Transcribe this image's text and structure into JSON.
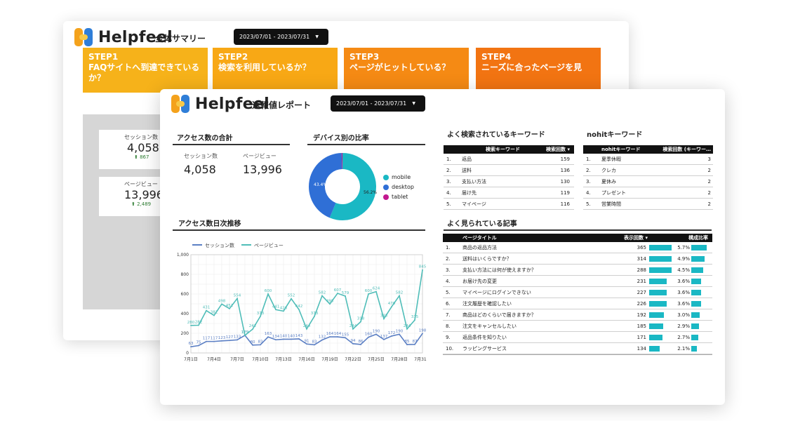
{
  "background_report": {
    "brand": "Helpfeel",
    "title": "全体サマリー",
    "date_range": "2023/07/01 - 2023/07/31",
    "steps": [
      {
        "label": "STEP1",
        "text": "FAQサイトへ到達できているか？",
        "color": "#f6b21a"
      },
      {
        "label": "STEP2",
        "text": "検索を利用しているか？",
        "color": "#f8a815"
      },
      {
        "label": "STEP3",
        "text": "ページがヒットしている？",
        "color": "#f58a14"
      },
      {
        "label": "STEP4",
        "text": "ニーズに合ったページを見",
        "color": "#f27412"
      }
    ],
    "kpis": [
      {
        "label": "セッション数",
        "value": "4,058",
        "delta": "⬆ 867"
      },
      {
        "label": "ページビュー",
        "value": "13,996",
        "delta": "⬆ 2,489"
      }
    ]
  },
  "report": {
    "brand": "Helpfeel",
    "title": "速報値レポート",
    "date_range": "2023/07/01 - 2023/07/31",
    "access_total": {
      "title": "アクセス数の合計",
      "sessions_label": "セッション数",
      "sessions_value": "4,058",
      "pageviews_label": "ページビュー",
      "pageviews_value": "13,996"
    },
    "device": {
      "title": "デバイス別の比率",
      "labels": [
        "56.2%",
        "43.4%"
      ]
    },
    "daily": {
      "title": "アクセス数日次推移"
    },
    "keywords": {
      "title": "よく検索されているキーワード",
      "col_keyword": "検索キーワード",
      "col_count": "検索回数 ▾",
      "rows": [
        {
          "n": "1.",
          "k": "返品",
          "v": "159"
        },
        {
          "n": "2.",
          "k": "送料",
          "v": "136"
        },
        {
          "n": "3.",
          "k": "支払い方法",
          "v": "130"
        },
        {
          "n": "4.",
          "k": "届け先",
          "v": "119"
        },
        {
          "n": "5.",
          "k": "マイページ",
          "v": "116"
        }
      ]
    },
    "nohit": {
      "title": "nohitキーワード",
      "col_keyword": "nohitキーワード",
      "col_count": "検索回数 (キーワー…",
      "rows": [
        {
          "n": "1.",
          "k": "夏季休暇",
          "v": "3"
        },
        {
          "n": "2.",
          "k": "クレカ",
          "v": "2"
        },
        {
          "n": "3.",
          "k": "夏休み",
          "v": "2"
        },
        {
          "n": "4.",
          "k": "プレゼント",
          "v": "2"
        },
        {
          "n": "5.",
          "k": "営業時間",
          "v": "2"
        }
      ]
    },
    "articles": {
      "title": "よく見られている記事",
      "col_title": "ページタイトル",
      "col_views": "表示回数 ▾",
      "col_ratio": "構成比率",
      "rows": [
        {
          "n": "1.",
          "t": "商品の返品方法",
          "v": "365",
          "r": "5.7%",
          "ratio": 5.7
        },
        {
          "n": "2.",
          "t": "送料はいくらですか？",
          "v": "314",
          "r": "4.9%",
          "ratio": 4.9
        },
        {
          "n": "3.",
          "t": "支払い方法には何が使えますか？",
          "v": "288",
          "r": "4.5%",
          "ratio": 4.5
        },
        {
          "n": "4.",
          "t": "お届け先の変更",
          "v": "231",
          "r": "3.6%",
          "ratio": 3.6
        },
        {
          "n": "5.",
          "t": "マイページにログインできない",
          "v": "227",
          "r": "3.6%",
          "ratio": 3.6
        },
        {
          "n": "6.",
          "t": "注文履歴を確認したい",
          "v": "226",
          "r": "3.6%",
          "ratio": 3.6
        },
        {
          "n": "7.",
          "t": "商品はどのくらいで届きますか？",
          "v": "192",
          "r": "3.0%",
          "ratio": 3.0
        },
        {
          "n": "8.",
          "t": "注文をキャンセルしたい",
          "v": "185",
          "r": "2.9%",
          "ratio": 2.9
        },
        {
          "n": "9.",
          "t": "返品条件を知りたい",
          "v": "171",
          "r": "2.7%",
          "ratio": 2.7
        },
        {
          "n": "10.",
          "t": "ラッピングサービス",
          "v": "134",
          "r": "2.1%",
          "ratio": 2.1
        }
      ]
    }
  },
  "chart_data": [
    {
      "type": "pie",
      "title": "デバイス別の比率",
      "categories": [
        "mobile",
        "desktop",
        "tablet"
      ],
      "values": [
        56.2,
        43.4,
        0.4
      ],
      "colors": [
        "#1ab8c4",
        "#2f6fd6",
        "#c2188f"
      ],
      "legend": "right"
    },
    {
      "type": "line",
      "title": "アクセス数日次推移",
      "x": [
        "7月1日",
        "7月2日",
        "7月3日",
        "7月4日",
        "7月5日",
        "7月6日",
        "7月7日",
        "7月8日",
        "7月9日",
        "7月10日",
        "7月11日",
        "7月12日",
        "7月13日",
        "7月14日",
        "7月15日",
        "7月16日",
        "7月17日",
        "7月18日",
        "7月19日",
        "7月20日",
        "7月21日",
        "7月22日",
        "7月23日",
        "7月24日",
        "7月25日",
        "7月26日",
        "7月27日",
        "7月28日",
        "7月29日",
        "7月30日",
        "7月31日"
      ],
      "xticks": [
        "7月1日",
        "7月4日",
        "7月7日",
        "7月10日",
        "7月13日",
        "7月16日",
        "7月19日",
        "7月22日",
        "7月25日",
        "7月28日",
        "7月31日"
      ],
      "ylim": [
        0,
        1000
      ],
      "yticks": [
        "0",
        "200",
        "400",
        "600",
        "800",
        "1,000"
      ],
      "legend": "top",
      "grid": true,
      "series": [
        {
          "name": "セッション数",
          "color": "#5b7fc4",
          "values": [
            63,
            75,
            117,
            117,
            123,
            127,
            133,
            179,
            80,
            83,
            163,
            134,
            140,
            140,
            143,
            91,
            83,
            132,
            164,
            164,
            155,
            94,
            86,
            160,
            190,
            137,
            172,
            190,
            85,
            87,
            198
          ]
        },
        {
          "name": "ページビュー",
          "color": "#4fbdb8",
          "values": [
            280,
            282,
            431,
            382,
            498,
            451,
            554,
            179,
            242,
            373,
            600,
            441,
            426,
            552,
            442,
            244,
            373,
            582,
            498,
            607,
            579,
            244,
            318,
            600,
            624,
            348,
            470,
            582,
            244,
            335,
            845
          ]
        }
      ]
    }
  ]
}
